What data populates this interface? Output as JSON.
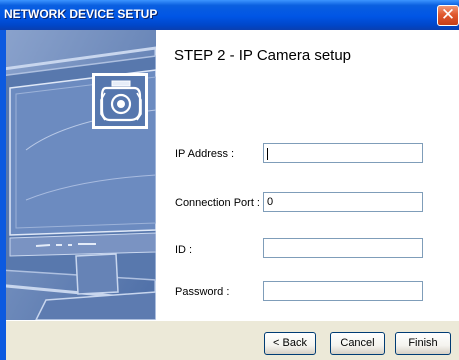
{
  "window": {
    "title": "NETWORK DEVICE SETUP",
    "close_glyph": "✕"
  },
  "step": {
    "title": "STEP 2 -  IP Camera setup"
  },
  "fields": [
    {
      "label": "IP Address :",
      "value": ""
    },
    {
      "label": "Connection Port :",
      "value": "0"
    },
    {
      "label": "ID :",
      "value": ""
    },
    {
      "label": "Password :",
      "value": ""
    }
  ],
  "buttons": {
    "back": "< Back",
    "cancel": "Cancel",
    "finish": "Finish"
  },
  "colors": {
    "titlebar": "#0055e5",
    "sidebar": "#6683b6",
    "close": "#e0582e"
  },
  "icons": [
    "camera-icon",
    "monitor-graphic",
    "close-icon"
  ]
}
